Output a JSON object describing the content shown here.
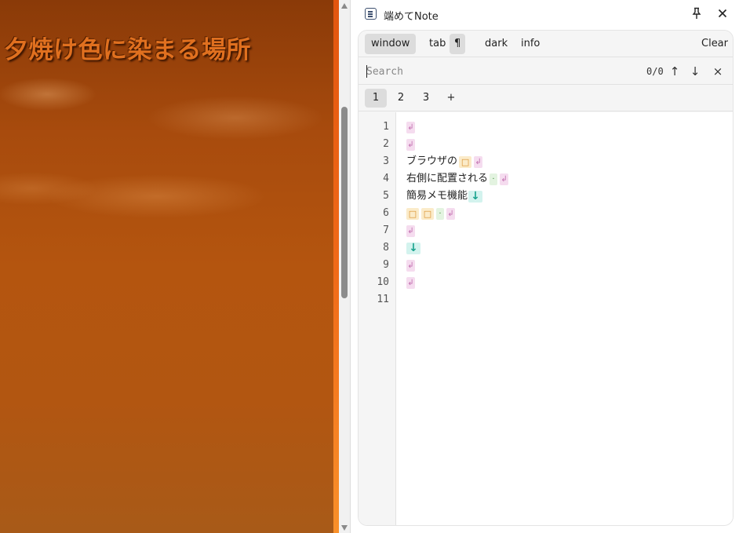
{
  "page": {
    "title": "夕焼け色に染まる場所"
  },
  "app": {
    "title": "端めてNote",
    "pin_icon": "pin-icon",
    "close_icon": "close-icon"
  },
  "toolbar": {
    "window": "window",
    "tab": "tab",
    "pilcrow": "¶",
    "dark": "dark",
    "info": "info",
    "clear": "Clear"
  },
  "search": {
    "placeholder": "Search",
    "count": "0/0",
    "prev": "↑",
    "next": "↓",
    "close": "×"
  },
  "pages": {
    "tabs": [
      "1",
      "2",
      "3"
    ],
    "add": "+"
  },
  "editor": {
    "line_numbers": [
      "1",
      "2",
      "3",
      "4",
      "5",
      "6",
      "7",
      "8",
      "9",
      "10",
      "11"
    ],
    "markers": {
      "newline": "↲",
      "fullwidth_space": "□",
      "halfwidth_space": "·",
      "linefeed": "↓"
    },
    "lines": [
      "",
      "",
      "ブラウザの",
      "右側に配置される",
      "簡易メモ機能",
      "",
      "",
      "",
      "",
      "",
      ""
    ]
  }
}
